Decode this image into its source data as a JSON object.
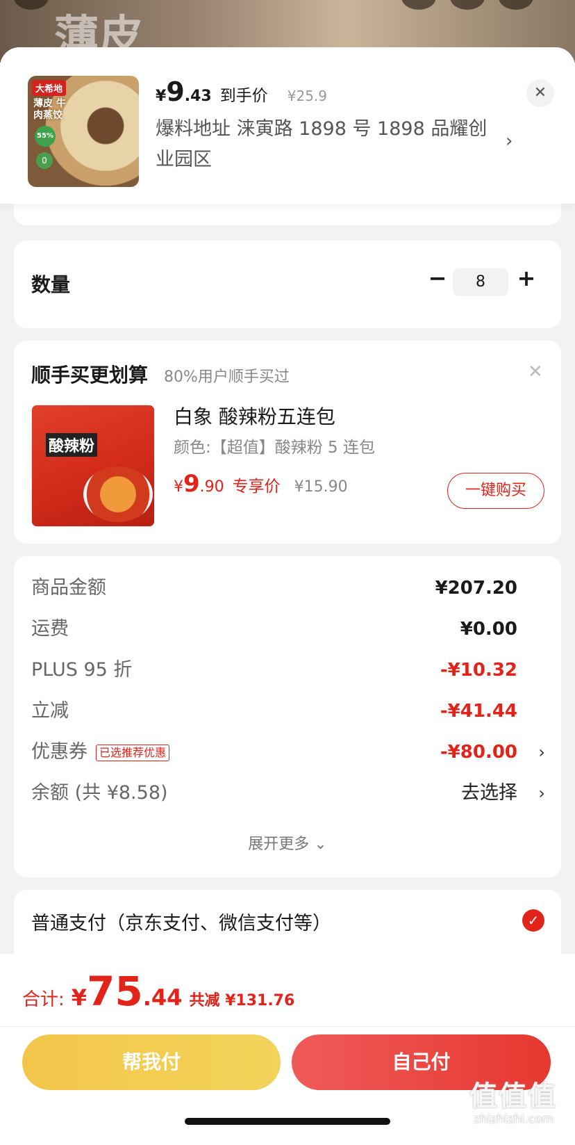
{
  "backdrop": {
    "text": "薄皮"
  },
  "product": {
    "brand": "大希地",
    "image_label": "薄皮 牛肉蒸饺",
    "badge_a": "55%",
    "badge_b": "0",
    "price_yen": "¥",
    "price_int": "9",
    "price_dec": ".43",
    "price_tag": "到手价",
    "orig_price": "¥25.9",
    "address": "爆料地址  涞寅路 1898 号 1898 品耀创业园区",
    "close_icon": "close-icon"
  },
  "quantity": {
    "label": "数量",
    "value": "8"
  },
  "upsell": {
    "title": "顺手买更划算",
    "subtitle": "80%用户顺手买过",
    "image_word": "酸辣粉",
    "name": "白象 酸辣粉五连包",
    "spec": "颜色:【超值】酸辣粉 5 连包",
    "price_yen": "¥",
    "price_int": "9",
    "price_dec": ".90",
    "price_tag": "专享价",
    "orig_price": "¥15.90",
    "buy_label": "一键购买"
  },
  "summary": {
    "rows": [
      {
        "label": "商品金额",
        "value": "¥207.20"
      },
      {
        "label": "运费",
        "value": "¥0.00"
      },
      {
        "label": "PLUS 95 折",
        "value": "-¥10.32"
      },
      {
        "label": "立减",
        "value": "-¥41.44"
      },
      {
        "label": "优惠券",
        "badge": "已选推荐优惠",
        "value": "-¥80.00"
      },
      {
        "label": "余额 (共 ¥8.58)",
        "value": "去选择"
      }
    ],
    "more_label": "展开更多 ⌄"
  },
  "payment": {
    "label": "普通支付（京东支付、微信支付等）"
  },
  "bottom": {
    "total_label": "合计:",
    "total_yen": "¥",
    "total_int": "75",
    "total_dec": ".44",
    "saved": "共减 ¥131.76",
    "help_pay": "帮我付",
    "self_pay": "自己付"
  },
  "watermark": {
    "main": "值值值",
    "sub": "zhizhizhi.com"
  },
  "colors": {
    "accent_red": "#e2231a",
    "help_yellow": "#f3c64a",
    "self_red": "#e6382f"
  }
}
